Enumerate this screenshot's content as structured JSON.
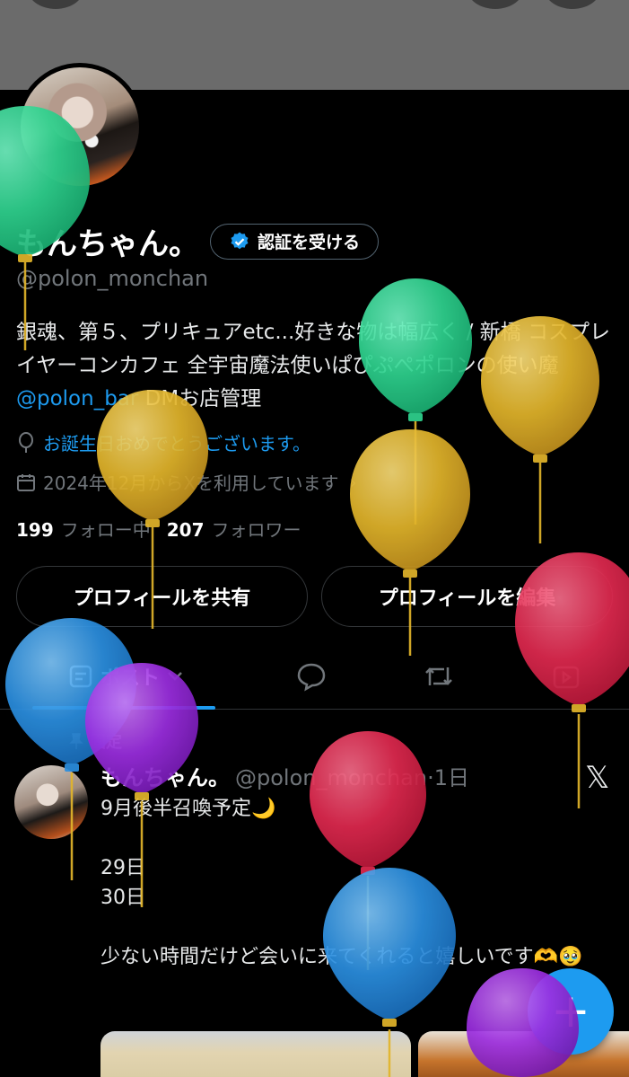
{
  "profile": {
    "name": "もんちゃん。",
    "verify_label": "認証を受ける",
    "handle": "@polon_monchan",
    "bio_text": "銀魂、第５、プリキュアetc...好きな物は幅広く / 新橋 コスプレイヤーコンカフェ 全宇宙魔法使いぱぴぷぺポロンの使い魔 ",
    "bio_link": "@polon_bar",
    "bio_tail": " DMお店管理",
    "birthday": "お誕生日おめでとうございます。",
    "joined": "2024年12月からXを利用しています",
    "following_count": "199",
    "following_label": "フォロー中",
    "followers_count": "207",
    "followers_label": "フォロワー"
  },
  "actions": {
    "share_label": "プロフィールを共有",
    "edit_label": "プロフィールを編集"
  },
  "tabs": {
    "posts_label": "ポスト"
  },
  "post": {
    "pinned_label": "固定",
    "name": "もんちゃん。",
    "handle_time": "@polon_monchan·1日",
    "body": "9月後半召喚予定🌙\n\n29日\n30日\n\n少ない時間だけど会いに来てくれると嬉しいです🫶🥹"
  },
  "fab": {
    "label": "+"
  },
  "colors": {
    "accent": "#1d9bf0",
    "balloon_green": "#2fd38f",
    "balloon_yellow": "#e2b52b",
    "balloon_red": "#e0294f",
    "balloon_blue": "#2b8fe0",
    "balloon_purple": "#9b2ee0"
  }
}
